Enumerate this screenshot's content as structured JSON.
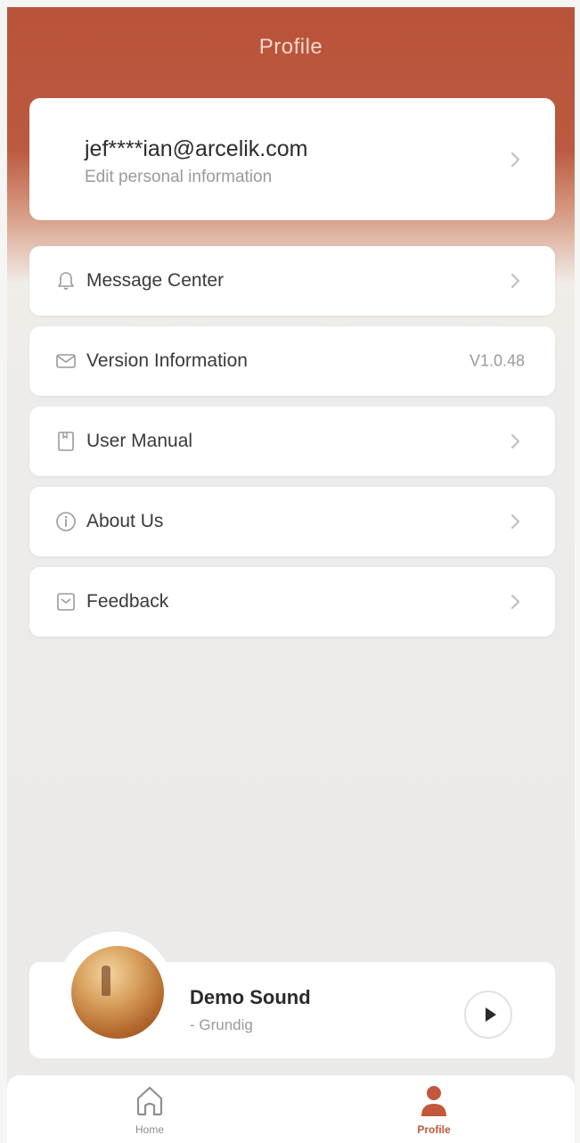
{
  "header": {
    "title": "Profile"
  },
  "account": {
    "email": "jef****ian@arcelik.com",
    "subtitle": "Edit personal information"
  },
  "menu": [
    {
      "label": "Message Center",
      "icon": "bell-icon",
      "value": ""
    },
    {
      "label": "Version Information",
      "icon": "mail-icon",
      "value": "V1.0.48"
    },
    {
      "label": "User Manual",
      "icon": "book-icon",
      "value": ""
    },
    {
      "label": "About Us",
      "icon": "info-icon",
      "value": ""
    },
    {
      "label": "Feedback",
      "icon": "feedback-icon",
      "value": ""
    }
  ],
  "player": {
    "title": "Demo Sound",
    "artist": "- Grundig"
  },
  "tabs": [
    {
      "label": "Home",
      "icon": "home-icon",
      "active": false
    },
    {
      "label": "Profile",
      "icon": "person-icon",
      "active": true
    }
  ],
  "colors": {
    "accent": "#c4573c",
    "header": "#b9533a",
    "background": "#ebeae8"
  }
}
